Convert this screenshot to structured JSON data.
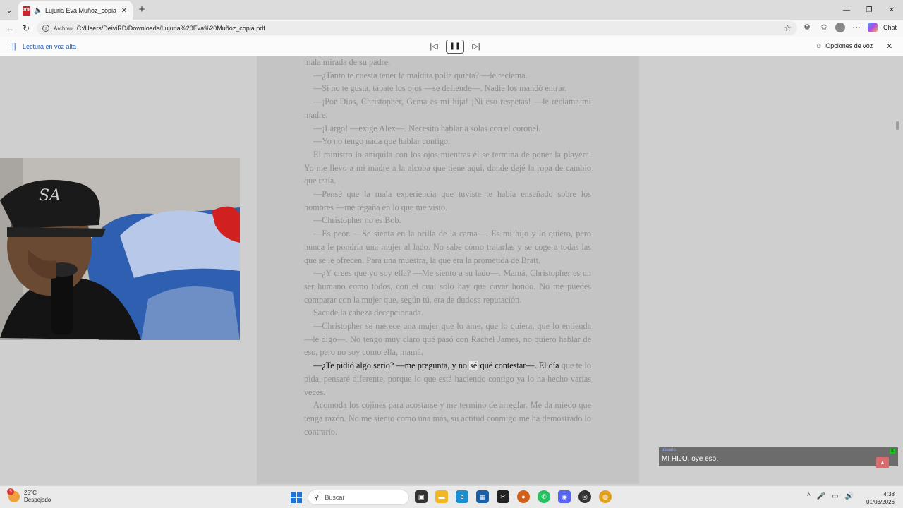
{
  "browser": {
    "tab_title": "Lujuria Eva Muñoz_copia.pdf",
    "address_label": "Archivo",
    "url": "C:/Users/DeiviRD/Downloads/Lujuria%20Eva%20Muñoz_copia.pdf",
    "chat_label": "Chat"
  },
  "read_aloud": {
    "title": "Lectura en voz alta",
    "voice_options": "Opciones de voz"
  },
  "document": {
    "paragraphs": [
      {
        "text": "mala mirada de su padre.",
        "indent": false
      },
      {
        "text": "—¿Tanto te cuesta tener la maldita polla quieta? —le reclama.",
        "indent": true
      },
      {
        "text": "—Si no te gusta, tápate los ojos —se defiende—. Nadie los mandó entrar.",
        "indent": true
      },
      {
        "text": "—¡Por Dios, Christopher, Gema es mi hija! ¡Ni eso respetas! —le reclama mi madre.",
        "indent": true
      },
      {
        "text": "—¡Largo! —exige Alex—. Necesito hablar a solas con el coronel.",
        "indent": true
      },
      {
        "text": "—Yo no tengo nada que hablar contigo.",
        "indent": true
      },
      {
        "text": "El ministro lo aniquila con los ojos mientras él se termina de poner la playera. Yo me llevo a mi madre a la alcoba que tiene aquí, donde dejé la ropa de cambio que traía.",
        "indent": true
      },
      {
        "text": "—Pensé que la mala experiencia que tuviste te había enseñado sobre los hombres —me regaña en lo que me visto.",
        "indent": true
      },
      {
        "text": "—Christopher no es Bob.",
        "indent": true
      },
      {
        "text": "—Es peor. —Se sienta en la orilla de la cama—. Es mi hijo y lo quiero, pero nunca le pondría una mujer al lado. No sabe cómo tratarlas y se coge a todas las que se le ofrecen. Para una muestra, la que era la prometida de Bratt.",
        "indent": true
      },
      {
        "text": "—¿Y crees que yo soy ella? —Me siento a su lado—. Mamá, Christopher es un ser humano como todos, con el cual solo hay que cavar hondo. No me puedes comparar con la mujer que, según tú, era de dudosa reputación.",
        "indent": true
      },
      {
        "text": "Sacude la cabeza decepcionada.",
        "indent": true
      },
      {
        "text": "—Christopher se merece una mujer que lo ame, que lo quiera, que lo entienda —le digo—. No tengo muy claro qué pasó con Rachel James, no quiero hablar de eso, pero no soy como ella, mamá.",
        "indent": true
      }
    ],
    "highlight_before": "—¿Te pidió algo serio? —me pregunta, y no ",
    "highlight_word": "sé",
    "highlight_after": " qué contestar—. El día",
    "highlight_rest": "que te lo pida, pensaré diferente, porque lo que está haciendo contigo ya lo ha hecho varias veces.",
    "final_paragraph": "Acomoda los cojines para acostarse y me termino de arreglar. Me da miedo que tenga razón. No me siento como una más, su actitud conmigo me ha demostrado lo contrario."
  },
  "chat_overlay": {
    "username": "usuario",
    "message": "MI HIJO, oye eso."
  },
  "taskbar": {
    "temperature": "25°C",
    "weather": "Despejado",
    "weather_badge": "5",
    "search_placeholder": "Buscar",
    "time": "4:38",
    "date": "01/03/2026"
  }
}
